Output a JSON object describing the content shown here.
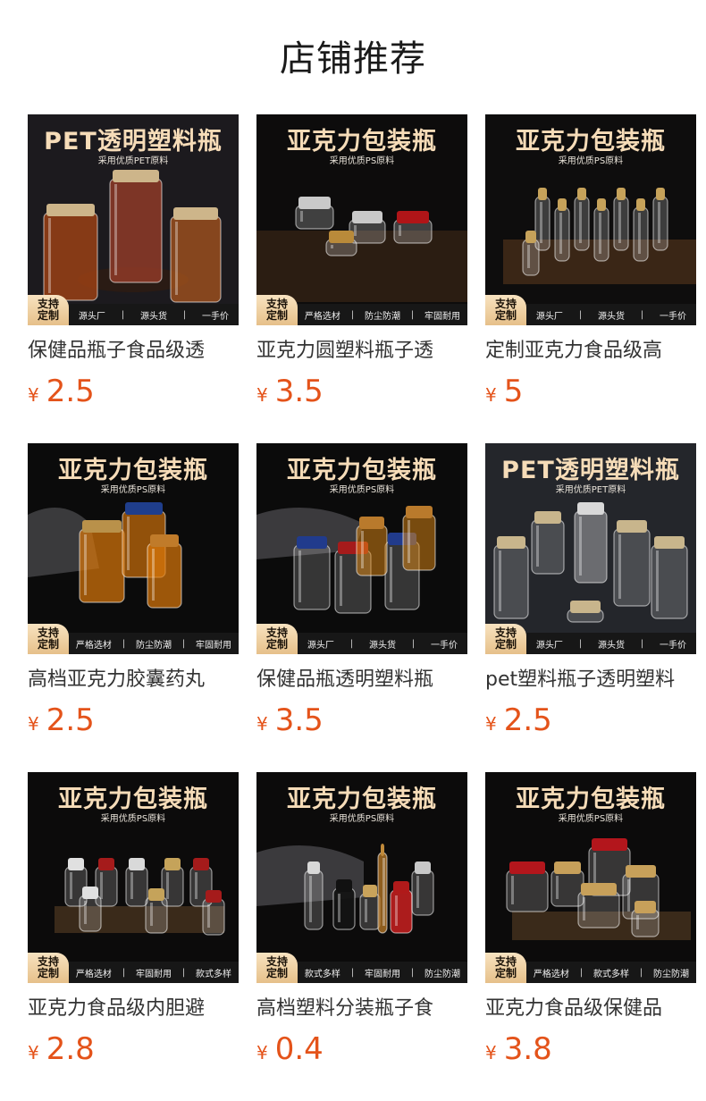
{
  "section": {
    "title": "店铺推荐"
  },
  "colors": {
    "price": "#e4531a",
    "banner_text": "#f6dcb8",
    "badge": "#e6c08a",
    "thumb_bg": "#0c0c0d"
  },
  "products": [
    {
      "banner_title": "PET透明塑料瓶",
      "banner_subtitle": "采用优质PET原料",
      "badge": [
        "支持",
        "定制"
      ],
      "features": [
        "源头厂",
        "源头货",
        "一手价"
      ],
      "name": "保健品瓶子食品级透",
      "currency": "¥",
      "price": "2.5",
      "scene": "pet-jars-food"
    },
    {
      "banner_title": "亚克力包装瓶",
      "banner_subtitle": "采用优质PS原料",
      "badge": [
        "支持",
        "定制"
      ],
      "features": [
        "严格选材",
        "防尘防潮",
        "牢固耐用"
      ],
      "name": "亚克力圆塑料瓶子透",
      "currency": "¥",
      "price": "3.5",
      "scene": "round-jars"
    },
    {
      "banner_title": "亚克力包装瓶",
      "banner_subtitle": "采用优质PS原料",
      "badge": [
        "支持",
        "定制"
      ],
      "features": [
        "源头厂",
        "源头货",
        "一手价"
      ],
      "name": "定制亚克力食品级高",
      "currency": "¥",
      "price": "5",
      "scene": "tall-bottles-tray"
    },
    {
      "banner_title": "亚克力包装瓶",
      "banner_subtitle": "采用优质PS原料",
      "badge": [
        "支持",
        "定制"
      ],
      "features": [
        "严格选材",
        "防尘防潮",
        "牢固耐用"
      ],
      "name": "高档亚克力胶囊药丸",
      "currency": "¥",
      "price": "2.5",
      "scene": "amber-bottles"
    },
    {
      "banner_title": "亚克力包装瓶",
      "banner_subtitle": "采用优质PS原料",
      "badge": [
        "支持",
        "定制"
      ],
      "features": [
        "源头厂",
        "源头货",
        "一手价"
      ],
      "name": "保健品瓶透明塑料瓶",
      "currency": "¥",
      "price": "3.5",
      "scene": "colored-caps"
    },
    {
      "banner_title": "PET透明塑料瓶",
      "banner_subtitle": "采用优质PET原料",
      "badge": [
        "支持",
        "定制"
      ],
      "features": [
        "源头厂",
        "源头货",
        "一手价"
      ],
      "name": "pet塑料瓶子透明塑料",
      "currency": "¥",
      "price": "2.5",
      "scene": "pet-bottles-grey"
    },
    {
      "banner_title": "亚克力包装瓶",
      "banner_subtitle": "采用优质PS原料",
      "badge": [
        "支持",
        "定制"
      ],
      "features": [
        "严格选材",
        "牢固耐用",
        "款式多样"
      ],
      "name": "亚克力食品级内胆避",
      "currency": "¥",
      "price": "2.8",
      "scene": "small-vials"
    },
    {
      "banner_title": "亚克力包装瓶",
      "banner_subtitle": "采用优质PS原料",
      "badge": [
        "支持",
        "定制"
      ],
      "features": [
        "款式多样",
        "牢固耐用",
        "防尘防潮"
      ],
      "name": "高档塑料分装瓶子食",
      "currency": "¥",
      "price": "0.4",
      "scene": "mixed-bottles"
    },
    {
      "banner_title": "亚克力包装瓶",
      "banner_subtitle": "采用优质PS原料",
      "badge": [
        "支持",
        "定制"
      ],
      "features": [
        "严格选材",
        "款式多样",
        "防尘防潮"
      ],
      "name": "亚克力食品级保健品",
      "currency": "¥",
      "price": "3.8",
      "scene": "wide-jars-tray"
    }
  ]
}
